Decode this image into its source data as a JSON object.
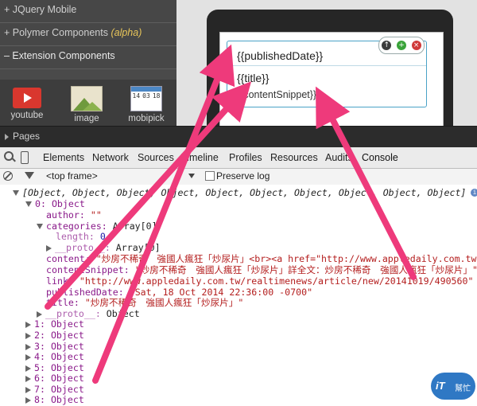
{
  "sidebar": {
    "categories": [
      {
        "label": "+ JQuery Mobile",
        "suffix": ""
      },
      {
        "label": "+ Polymer Components",
        "suffix": "(alpha)"
      },
      {
        "label": "– Extension Components",
        "suffix": ""
      }
    ],
    "icons": [
      {
        "label": "youtube",
        "icon": "youtube-icon"
      },
      {
        "label": "image",
        "icon": "image-icon"
      },
      {
        "label": "mobipick",
        "icon": "calendar-icon"
      }
    ],
    "calendar_numbers": [
      "14",
      "03",
      "18"
    ]
  },
  "pages_label": "Pages",
  "card": {
    "published": "{{publishedDate}}",
    "title": "{{title}}",
    "snippet": "{{contentSnippet}}"
  },
  "devtools": {
    "tabs": [
      "Elements",
      "Network",
      "Sources",
      "Timeline",
      "Profiles",
      "Resources",
      "Audits",
      "Console"
    ],
    "frame": "<top frame>",
    "preserve_log": "Preserve log"
  },
  "console": {
    "array_summary": "[Object, Object, Object, Object, Object, Object, Object, Object, Object, Object]",
    "obj0_header": "0: Object",
    "author_key": "author:",
    "author_val": "\"\"",
    "categories_key": "categories:",
    "categories_val": "Array[0]",
    "length_key": "length:",
    "length_val": "0",
    "proto_key": "__proto__:",
    "proto_array_val": "Array[0]",
    "content_key": "content:",
    "content_val": "\"炒房不稀奇　強國人瘋狂「炒尿片」<br><a href=\"http://www.appledaily.com.tw",
    "snippet_key": "contentSnippet:",
    "snippet_val": "\"炒房不稀奇　強國人瘋狂「炒尿片」詳全文：炒房不稀奇　強國人瘋狂「炒尿片」\"",
    "link_key": "link:",
    "link_val": "\"http://www.appledaily.com.tw/realtimenews/article/new/20141019/490560\"",
    "pubdate_key": "publishedDate:",
    "pubdate_val": "\"Sat, 18 Oct 2014 22:36:00 -0700\"",
    "title_key": "title:",
    "title_val": "\"炒房不稀奇　強國人瘋狂「炒尿片」\"",
    "proto_obj_val": "Object",
    "collapsed": [
      "1: Object",
      "2: Object",
      "3: Object",
      "4: Object",
      "5: Object",
      "6: Object",
      "7: Object",
      "8: Object"
    ]
  },
  "watermark": {
    "main": "iT",
    "sub": "幫忙"
  },
  "colors": {
    "arrow": "#ee3a7b",
    "card_border": "#4aa2c7",
    "console_key": "#8a1a8a",
    "console_string": "#b41e1e"
  }
}
